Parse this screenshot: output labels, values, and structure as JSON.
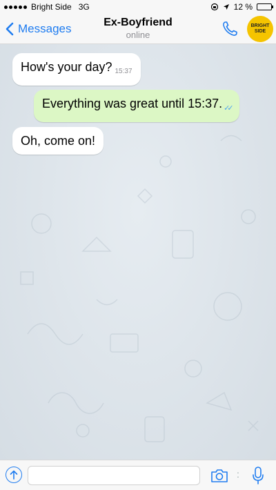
{
  "status_bar": {
    "carrier": "Bright Side",
    "network": "3G",
    "battery_text": "12 %",
    "battery_level": 0.12,
    "battery_color": "#e02020"
  },
  "nav": {
    "back_label": "Messages",
    "title": "Ex-Boyfriend",
    "subtitle": "online",
    "avatar_line1": "BRIGHT",
    "avatar_line2": "SIDE",
    "accent": "#1e7cf0"
  },
  "messages": [
    {
      "direction": "incoming",
      "text": "How's your day?",
      "time": "15:37"
    },
    {
      "direction": "outgoing",
      "text": "Everything was great until 15:37.",
      "status": "read"
    },
    {
      "direction": "incoming",
      "text": "Oh, come on!"
    }
  ],
  "input_bar": {
    "value": "",
    "placeholder": "",
    "separator": ":"
  },
  "icons": {
    "back": "chevron-left-icon",
    "call": "phone-icon",
    "attach": "arrow-up-circle-icon",
    "camera": "camera-icon",
    "mic": "microphone-icon",
    "read_receipt": "double-check-icon"
  },
  "colors": {
    "outgoing_bubble": "#dcf7c5",
    "incoming_bubble": "#ffffff",
    "chat_background": "#dde4ea"
  }
}
